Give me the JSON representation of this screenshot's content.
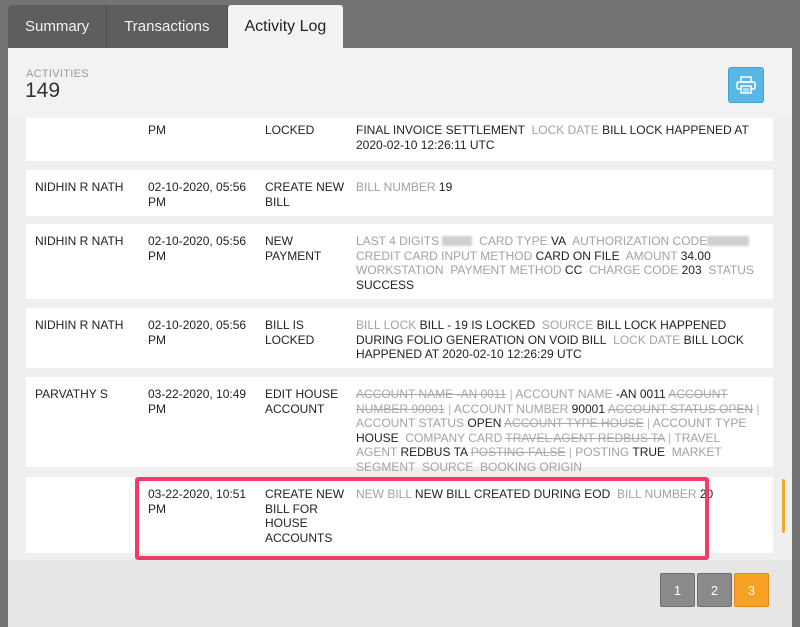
{
  "tabs": [
    {
      "label": "Summary"
    },
    {
      "label": "Transactions"
    },
    {
      "label": "Activity Log"
    }
  ],
  "header": {
    "activities_label": "ACTIVITIES",
    "activities_count": "149"
  },
  "print_button": {
    "icon": "print-icon"
  },
  "rows": [
    {
      "user": "",
      "date": "PM",
      "action": "LOCKED",
      "details": "FINAL INVOICE SETTLEMENT  LOCK DATE BILL LOCK HAPPENED AT 2020-02-10 12:26:11 UTC",
      "d": {
        "t1": "FINAL INVOICE SETTLEMENT",
        "k1": "LOCK DATE",
        "v1": "BILL LOCK HAPPENED AT 2020-02-10 12:26:11 UTC"
      }
    },
    {
      "user": "NIDHIN R NATH",
      "date": "02-10-2020, 05:56 PM",
      "action": "CREATE NEW BILL",
      "d": {
        "k1": "BILL NUMBER",
        "v1": "19"
      }
    },
    {
      "user": "NIDHIN R NATH",
      "date": "02-10-2020, 05:56 PM",
      "action": "NEW PAYMENT",
      "d": {
        "k1": "LAST 4 DIGITS",
        "k2": "CARD TYPE",
        "v2": "VA",
        "k3": "AUTHORIZATION CODE",
        "k4": "CREDIT CARD INPUT METHOD",
        "v4": "CARD ON FILE",
        "k5": "AMOUNT",
        "v5": "34.00",
        "k6": "WORKSTATION",
        "k7": "PAYMENT METHOD",
        "v7": "CC",
        "k8": "CHARGE CODE",
        "v8": "203",
        "k9": "STATUS",
        "v9": "SUCCESS"
      }
    },
    {
      "user": "NIDHIN R NATH",
      "date": "02-10-2020, 05:56 PM",
      "action": "BILL IS LOCKED",
      "d": {
        "k1": "BILL LOCK",
        "v1": "BILL - 19 IS LOCKED",
        "k2": "SOURCE",
        "v2": "BILL LOCK HAPPENED DURING FOLIO GENERATION ON VOID BILL",
        "k3": "LOCK DATE",
        "v3": "BILL LOCK HAPPENED AT 2020-02-10 12:26:29 UTC"
      }
    },
    {
      "user": "PARVATHY S",
      "date": "03-22-2020, 10:49 PM",
      "action": "EDIT HOUSE ACCOUNT",
      "d": {
        "s1": "ACCOUNT NAME -AN 0011",
        "k1": "ACCOUNT NAME",
        "v1": "-AN 0011",
        "s2": "ACCOUNT NUMBER 90001",
        "k2": "ACCOUNT NUMBER",
        "v2": "90001",
        "s3": "ACCOUNT STATUS OPEN",
        "k3": "ACCOUNT STATUS",
        "v3": "OPEN",
        "s4": "ACCOUNT TYPE HOUSE",
        "k4": "ACCOUNT TYPE",
        "v4": "HOUSE",
        "k5": "COMPANY CARD",
        "s6": "TRAVEL AGENT REDBUS TA",
        "k6": "TRAVEL AGENT",
        "v6": "REDBUS TA",
        "s7": "POSTING FALSE",
        "k7": "POSTING",
        "v7": "TRUE",
        "k8": "MARKET SEGMENT",
        "k9": "SOURCE",
        "k10": "BOOKING ORIGIN"
      }
    },
    {
      "user": "",
      "date": "03-22-2020, 10:51 PM",
      "action": "CREATE NEW BILL FOR HOUSE ACCOUNTS",
      "d": {
        "k1": "NEW BILL",
        "v1": "NEW BILL CREATED DURING EOD",
        "k2": "BILL NUMBER",
        "v2": "20"
      }
    }
  ],
  "pager": {
    "pages": [
      "1",
      "2",
      "3"
    ],
    "current": "3"
  },
  "colors": {
    "accent": "#f8a225",
    "highlight": "#f33a6b",
    "print_button": "#59b7e6"
  }
}
